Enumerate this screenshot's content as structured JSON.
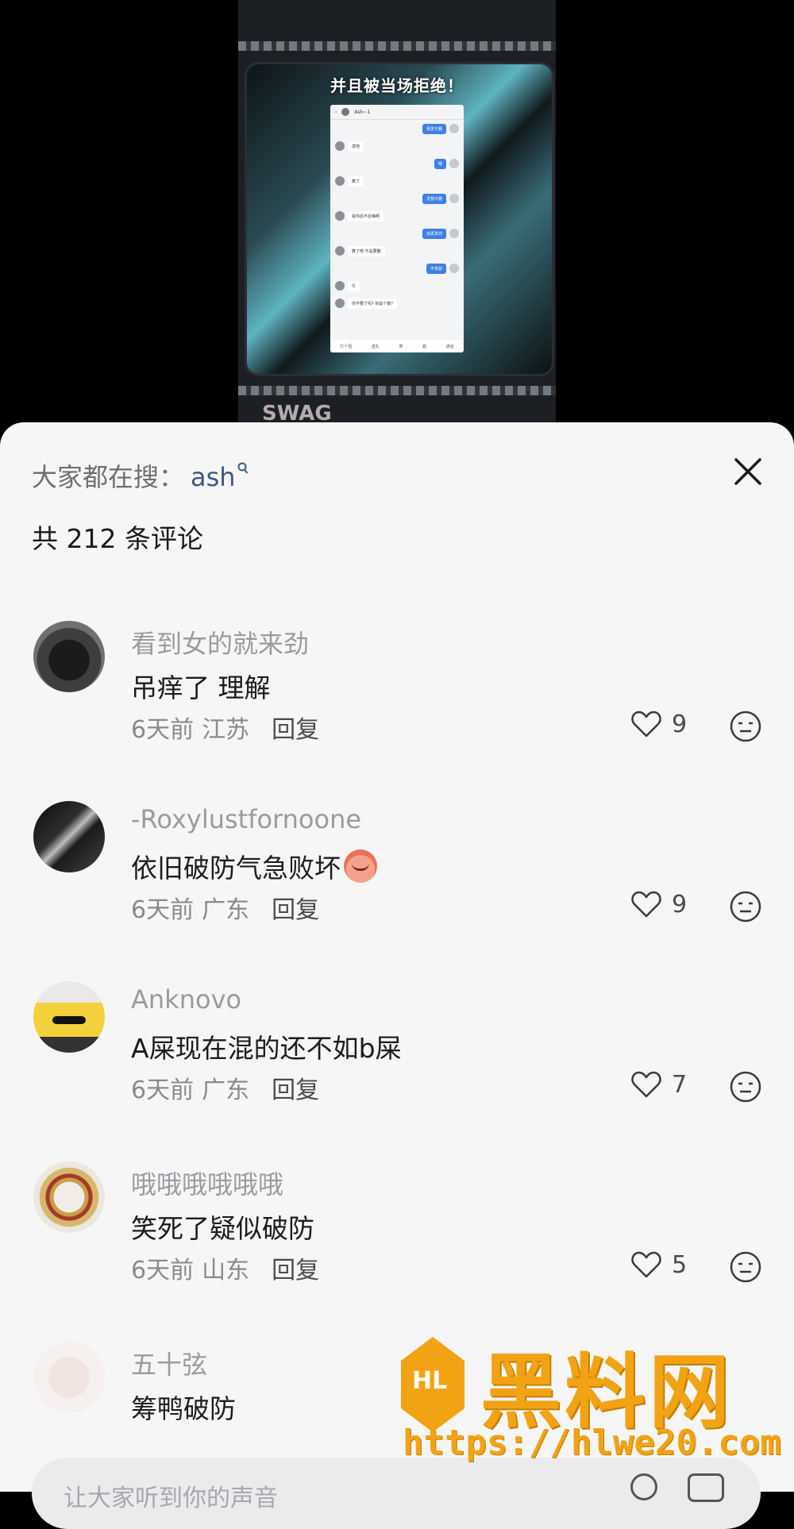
{
  "video": {
    "caption": "并且被当场拒绝！",
    "chat": {
      "title": "Ash~1",
      "messages": [
        {
          "side": "right",
          "text": "我发不删"
        },
        {
          "side": "left",
          "text": "发吧"
        },
        {
          "side": "right",
          "text": "嗯"
        },
        {
          "side": "left",
          "text": "算了"
        },
        {
          "side": "right",
          "text": "发我不删"
        },
        {
          "side": "left",
          "text": "看你后不后悔啊"
        },
        {
          "side": "right",
          "text": "我再发你"
        },
        {
          "side": "left",
          "text": "算了吧 不是要删"
        },
        {
          "side": "right",
          "text": "不发就"
        },
        {
          "side": "left",
          "text": "行"
        },
        {
          "side": "left",
          "text": "你不要了吗? 你是个鹅?"
        }
      ],
      "footer": [
        "打个招",
        "送礼",
        "表",
        "戳",
        "通话"
      ]
    },
    "bottom_art": "SWAG"
  },
  "sheet": {
    "search_hint_label": "大家都在搜：",
    "search_keyword": "ash",
    "comment_count": "共 212 条评论",
    "close_icon": "close-icon"
  },
  "comments": [
    {
      "name": "看到女的就来劲",
      "text": "吊痒了 理解",
      "time": "6天前",
      "region": "江苏",
      "reply": "回复",
      "likes": "9",
      "emoji": false
    },
    {
      "name": "-Roxylustfornoone",
      "text": "依旧破防气急败坏",
      "time": "6天前",
      "region": "广东",
      "reply": "回复",
      "likes": "9",
      "emoji": true
    },
    {
      "name": "Anknovo",
      "text": "A屎现在混的还不如b屎",
      "time": "6天前",
      "region": "广东",
      "reply": "回复",
      "likes": "7",
      "emoji": false
    },
    {
      "name": "哦哦哦哦哦哦",
      "text": "笑死了疑似破防",
      "time": "6天前",
      "region": "山东",
      "reply": "回复",
      "likes": "5",
      "emoji": false
    },
    {
      "name": "五十弦",
      "text": "筹鸭破防",
      "time": "",
      "region": "",
      "reply": "",
      "likes": "",
      "emoji": false
    }
  ],
  "watermark": {
    "title": "黑料网",
    "url": "https://hlwe20.com"
  },
  "input": {
    "placeholder": "让大家听到你的声音"
  },
  "colors": {
    "accent_keyword": "#3c5a84",
    "watermark": "#f2a314",
    "sheet_bg": "#f6f6f6"
  }
}
